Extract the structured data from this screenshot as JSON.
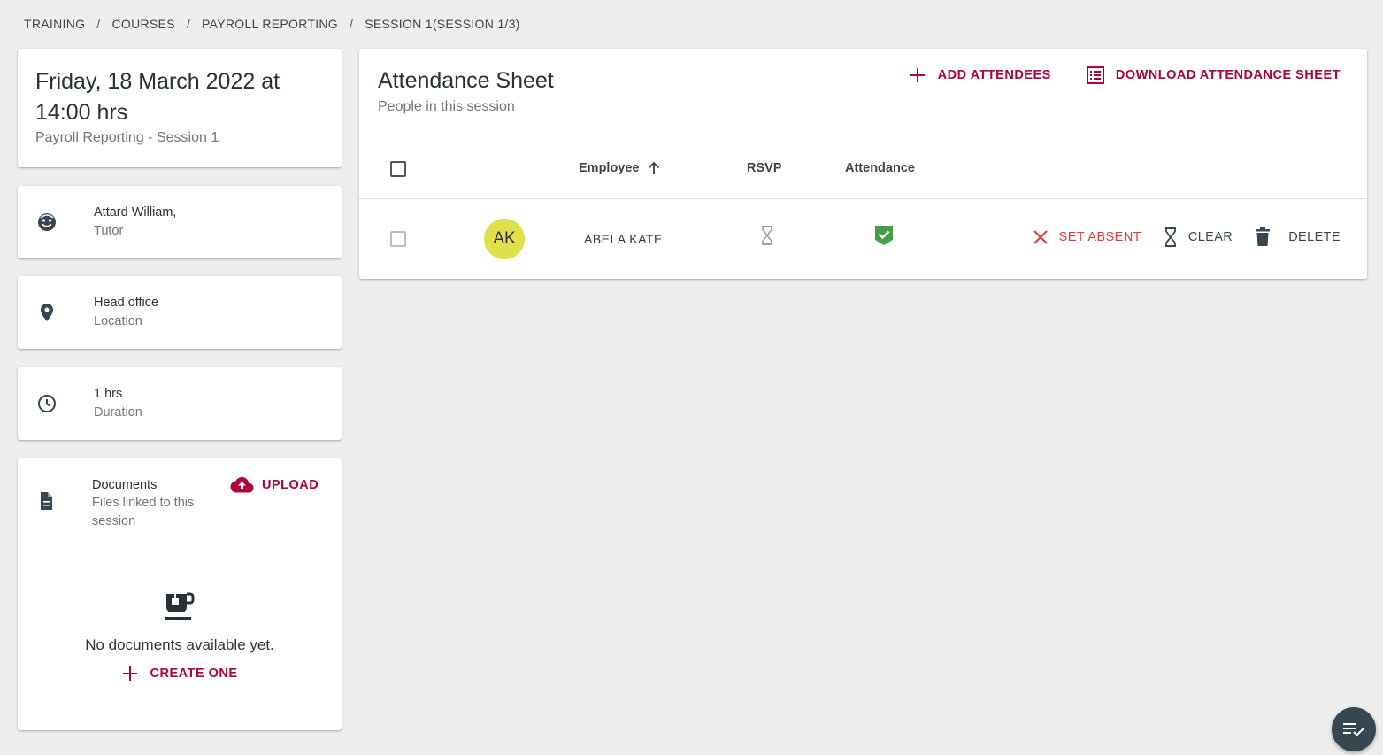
{
  "breadcrumb": {
    "items": [
      "TRAINING",
      "COURSES",
      "PAYROLL REPORTING",
      "SESSION 1(SESSION 1/3)"
    ],
    "separator": "/"
  },
  "session": {
    "title": "Friday, 18 March 2022 at 14:00 hrs",
    "subtitle": "Payroll Reporting - Session 1"
  },
  "tutor": {
    "name": "Attard William,",
    "role": "Tutor",
    "icon": "face-icon"
  },
  "location": {
    "name": "Head office",
    "label": "Location",
    "icon": "location-pin-icon"
  },
  "duration": {
    "value": "1 hrs",
    "label": "Duration",
    "icon": "clock-icon"
  },
  "documents": {
    "title": "Documents",
    "subtitle": "Files linked to this session",
    "upload_label": "UPLOAD",
    "empty_message": "No documents available yet.",
    "create_label": "CREATE ONE"
  },
  "attendance": {
    "title": "Attendance Sheet",
    "subtitle": "People in this session",
    "add_label": "ADD ATTENDEES",
    "download_label": "DOWNLOAD ATTENDANCE SHEET",
    "columns": {
      "employee": "Employee",
      "rsvp": "RSVP",
      "attendance": "Attendance"
    },
    "rows": [
      {
        "initials": "AK",
        "name": "ABELA KATE",
        "rsvp": "pending",
        "attendance": "present",
        "actions": {
          "absent": "SET ABSENT",
          "clear": "CLEAR",
          "delete": "DELETE"
        }
      }
    ]
  },
  "colors": {
    "accent": "#b0003a",
    "absent": "#e53935",
    "present": "#43a047",
    "avatar": "#e0e04a"
  }
}
